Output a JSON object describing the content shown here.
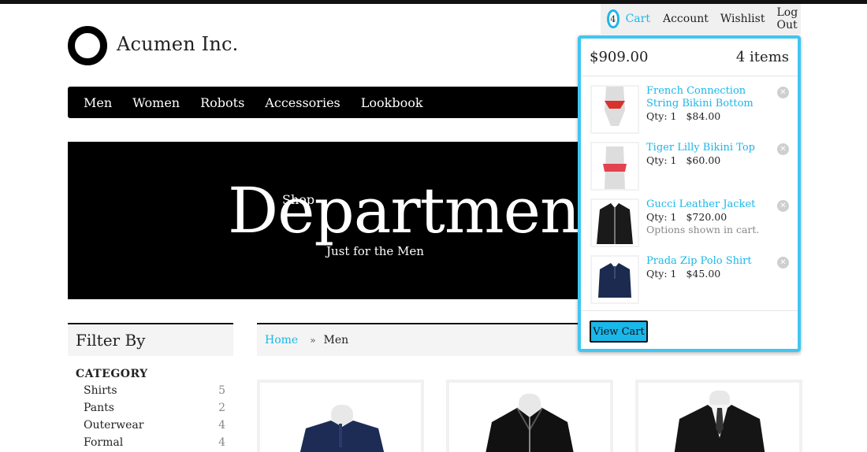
{
  "header": {
    "logo_text": "Acumen Inc.",
    "cart_count": "4",
    "links": {
      "cart": "Cart",
      "account": "Account",
      "wishlist": "Wishlist",
      "logout": "Log Out"
    }
  },
  "nav": [
    "Men",
    "Women",
    "Robots",
    "Accessories",
    "Lookbook"
  ],
  "hero": {
    "shop": "Shop",
    "title": "Department X",
    "subtitle": "Just for the Men"
  },
  "filter": {
    "title": "Filter By",
    "category_title": "CATEGORY",
    "categories": [
      {
        "name": "Shirts",
        "count": "5"
      },
      {
        "name": "Pants",
        "count": "2"
      },
      {
        "name": "Outerwear",
        "count": "4"
      },
      {
        "name": "Formal",
        "count": "4"
      }
    ]
  },
  "breadcrumb": {
    "home": "Home",
    "separator": "»",
    "current": "Men"
  },
  "cart": {
    "total": "$909.00",
    "items_count": "4 items",
    "items": [
      {
        "name": "French Connection String Bikini Bottom",
        "qty": "Qty: 1",
        "price": "$84.00",
        "note": ""
      },
      {
        "name": "Tiger Lilly Bikini Top",
        "qty": "Qty: 1",
        "price": "$60.00",
        "note": ""
      },
      {
        "name": "Gucci Leather Jacket",
        "qty": "Qty: 1",
        "price": "$720.00",
        "note": "Options shown in cart."
      },
      {
        "name": "Prada Zip Polo Shirt",
        "qty": "Qty: 1",
        "price": "$45.00",
        "note": ""
      }
    ],
    "view_cart_label": "View Cart"
  },
  "colors": {
    "accent": "#1ab7ea",
    "cart_border": "#40c6f0",
    "nav_bg": "#000000"
  }
}
